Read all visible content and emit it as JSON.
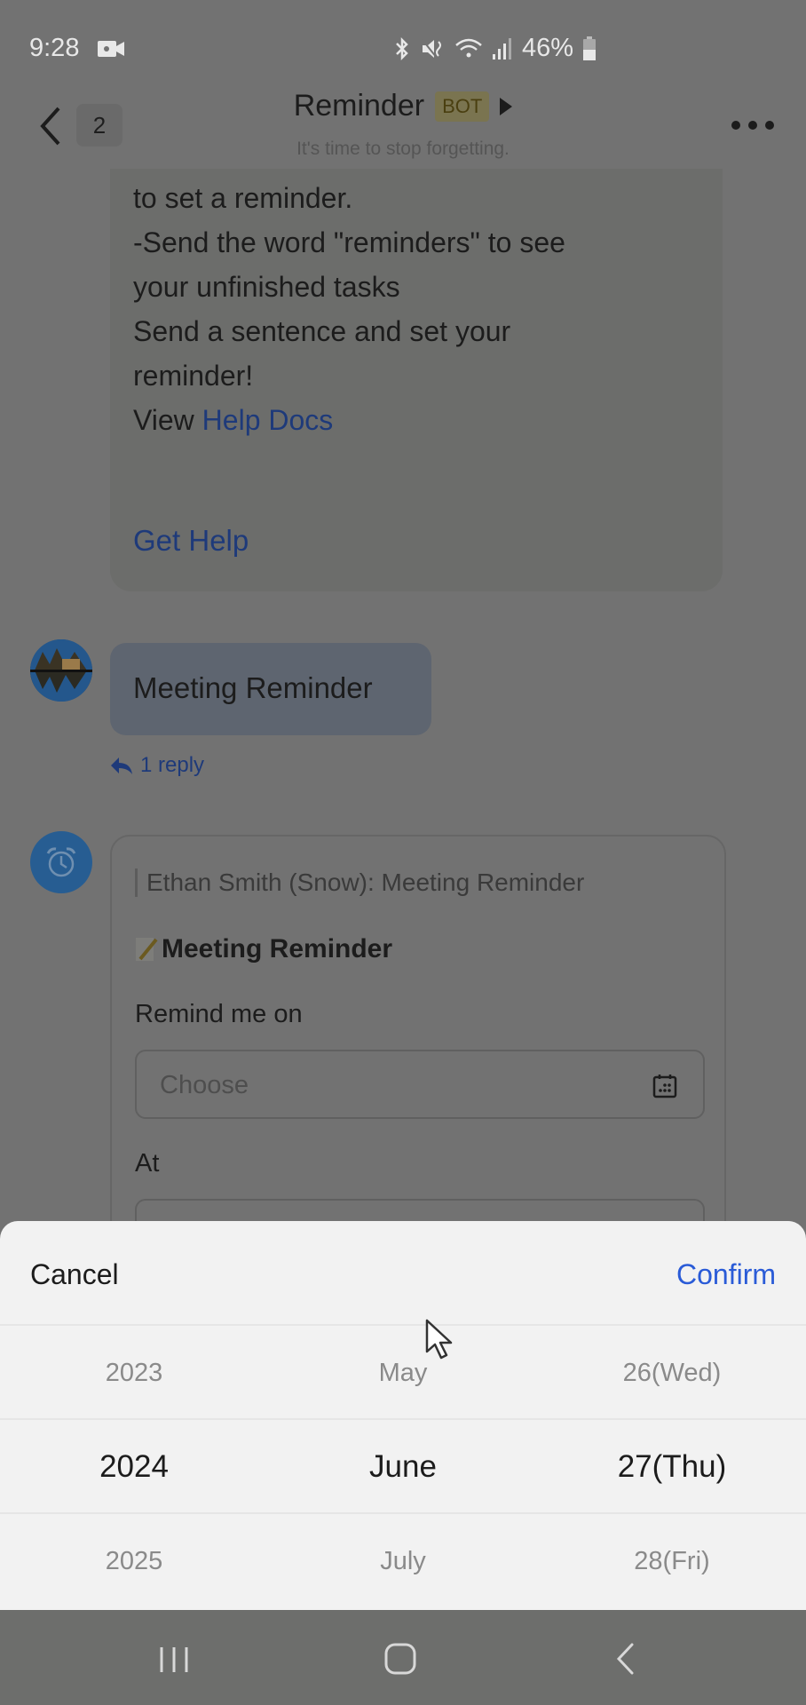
{
  "status_bar": {
    "time": "9:28",
    "battery": "46%",
    "icons": [
      "video-recording-icon",
      "bluetooth-icon",
      "mute-vibrate-icon",
      "wifi-icon",
      "signal-icon",
      "battery-icon"
    ]
  },
  "header": {
    "back_count": "2",
    "title": "Reminder",
    "bot_tag": "BOT",
    "subtitle": "It's time to stop forgetting."
  },
  "help_message": {
    "lines": [
      "to set a reminder.",
      "-Send the word \"reminders\" to see",
      "your unfinished tasks",
      "Send a sentence and set your",
      "reminder!"
    ],
    "view_prefix": "View ",
    "help_docs_link": "Help Docs",
    "get_help_link": "Get Help"
  },
  "user_message": {
    "text": "Meeting Reminder",
    "reply_count": "1 reply"
  },
  "reminder_card": {
    "quote": "Ethan Smith (Snow): Meeting Reminder",
    "title": "Meeting Reminder",
    "remind_on_label": "Remind me on",
    "date_placeholder": "Choose",
    "at_label": "At"
  },
  "date_picker": {
    "cancel_label": "Cancel",
    "confirm_label": "Confirm",
    "rows": [
      {
        "year": "2023",
        "month": "May",
        "day": "26(Wed)"
      },
      {
        "year": "2024",
        "month": "June",
        "day": "27(Thu)"
      },
      {
        "year": "2025",
        "month": "July",
        "day": "28(Fri)"
      }
    ],
    "selected": {
      "year": "2024",
      "month": "June",
      "day": "27(Thu)"
    }
  },
  "colors": {
    "accent_blue": "#2a5bd7",
    "link_blue_dimmed": "#1e3a7a",
    "sheet_bg": "#f2f2f2",
    "scrim": "#727272"
  }
}
